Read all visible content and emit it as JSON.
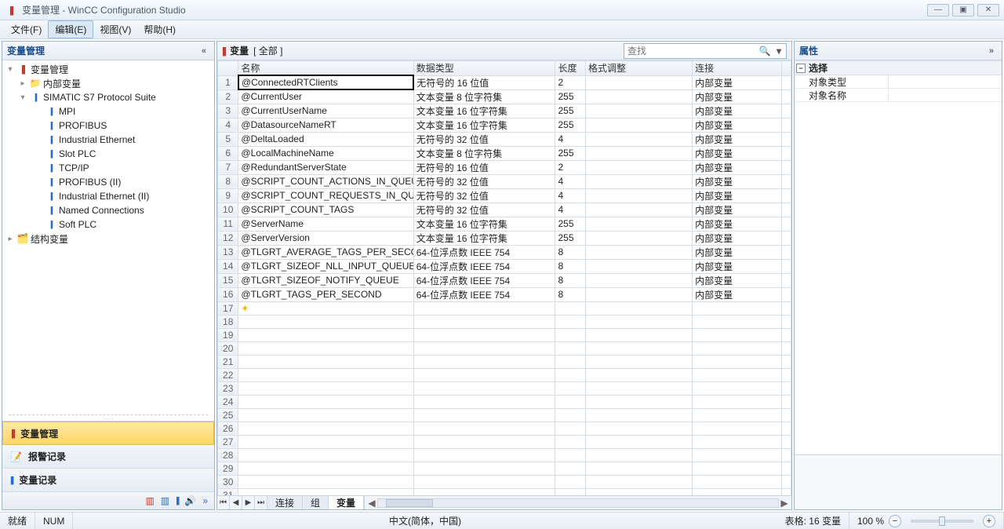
{
  "window": {
    "title": "变量管理 - WinCC Configuration Studio",
    "min": "—",
    "restore": "▣",
    "close": "✕"
  },
  "menu": {
    "file": "文件(F)",
    "edit": "编辑(E)",
    "view": "视图(V)",
    "help": "帮助(H)"
  },
  "sidebar": {
    "title": "变量管理",
    "collapse": "«",
    "tree": {
      "root": "变量管理",
      "internal": "内部变量",
      "protocol": "SIMATIC S7 Protocol Suite",
      "children": [
        "MPI",
        "PROFIBUS",
        "Industrial Ethernet",
        "Slot PLC",
        "TCP/IP",
        "PROFIBUS (II)",
        "Industrial Ethernet (II)",
        "Named Connections",
        "Soft PLC"
      ],
      "struct": "结构变量"
    },
    "nav": {
      "tags": "变量管理",
      "alarm": "报警记录",
      "taglog": "变量记录"
    }
  },
  "center": {
    "title_prefix": "变量",
    "title_suffix": "[ 全部 ]",
    "search_placeholder": "查找",
    "columns": {
      "name": "名称",
      "datatype": "数据类型",
      "length": "长度",
      "format": "格式调整",
      "connection": "连接"
    },
    "rows": [
      {
        "name": "@ConnectedRTClients",
        "datatype": "无符号的 16 位值",
        "length": "2",
        "format": "",
        "connection": "内部变量"
      },
      {
        "name": "@CurrentUser",
        "datatype": "文本变量 8 位字符集",
        "length": "255",
        "format": "",
        "connection": "内部变量"
      },
      {
        "name": "@CurrentUserName",
        "datatype": "文本变量 16 位字符集",
        "length": "255",
        "format": "",
        "connection": "内部变量"
      },
      {
        "name": "@DatasourceNameRT",
        "datatype": "文本变量 16 位字符集",
        "length": "255",
        "format": "",
        "connection": "内部变量"
      },
      {
        "name": "@DeltaLoaded",
        "datatype": "无符号的 32 位值",
        "length": "4",
        "format": "",
        "connection": "内部变量"
      },
      {
        "name": "@LocalMachineName",
        "datatype": "文本变量 8 位字符集",
        "length": "255",
        "format": "",
        "connection": "内部变量"
      },
      {
        "name": "@RedundantServerState",
        "datatype": "无符号的 16 位值",
        "length": "2",
        "format": "",
        "connection": "内部变量"
      },
      {
        "name": "@SCRIPT_COUNT_ACTIONS_IN_QUEUES",
        "datatype": "无符号的 32 位值",
        "length": "4",
        "format": "",
        "connection": "内部变量"
      },
      {
        "name": "@SCRIPT_COUNT_REQUESTS_IN_QUEUES",
        "datatype": "无符号的 32 位值",
        "length": "4",
        "format": "",
        "connection": "内部变量"
      },
      {
        "name": "@SCRIPT_COUNT_TAGS",
        "datatype": "无符号的 32 位值",
        "length": "4",
        "format": "",
        "connection": "内部变量"
      },
      {
        "name": "@ServerName",
        "datatype": "文本变量 16 位字符集",
        "length": "255",
        "format": "",
        "connection": "内部变量"
      },
      {
        "name": "@ServerVersion",
        "datatype": "文本变量 16 位字符集",
        "length": "255",
        "format": "",
        "connection": "内部变量"
      },
      {
        "name": "@TLGRT_AVERAGE_TAGS_PER_SECOND",
        "datatype": "64-位浮点数 IEEE 754",
        "length": "8",
        "format": "",
        "connection": "内部变量"
      },
      {
        "name": "@TLGRT_SIZEOF_NLL_INPUT_QUEUE",
        "datatype": "64-位浮点数 IEEE 754",
        "length": "8",
        "format": "",
        "connection": "内部变量"
      },
      {
        "name": "@TLGRT_SIZEOF_NOTIFY_QUEUE",
        "datatype": "64-位浮点数 IEEE 754",
        "length": "8",
        "format": "",
        "connection": "内部变量"
      },
      {
        "name": "@TLGRT_TAGS_PER_SECOND",
        "datatype": "64-位浮点数 IEEE 754",
        "length": "8",
        "format": "",
        "connection": "内部变量"
      }
    ],
    "empty_rows": 15,
    "tabs": {
      "conn": "连接",
      "group": "组",
      "tags": "变量"
    }
  },
  "props": {
    "title": "属性",
    "collapse": "»",
    "group_select": "选择",
    "object_type": "对象类型",
    "object_name": "对象名称"
  },
  "status": {
    "ready": "就绪",
    "num": "NUM",
    "lang": "中文(简体，中国)",
    "table": "表格: 16 变量",
    "zoom": "100 %"
  }
}
